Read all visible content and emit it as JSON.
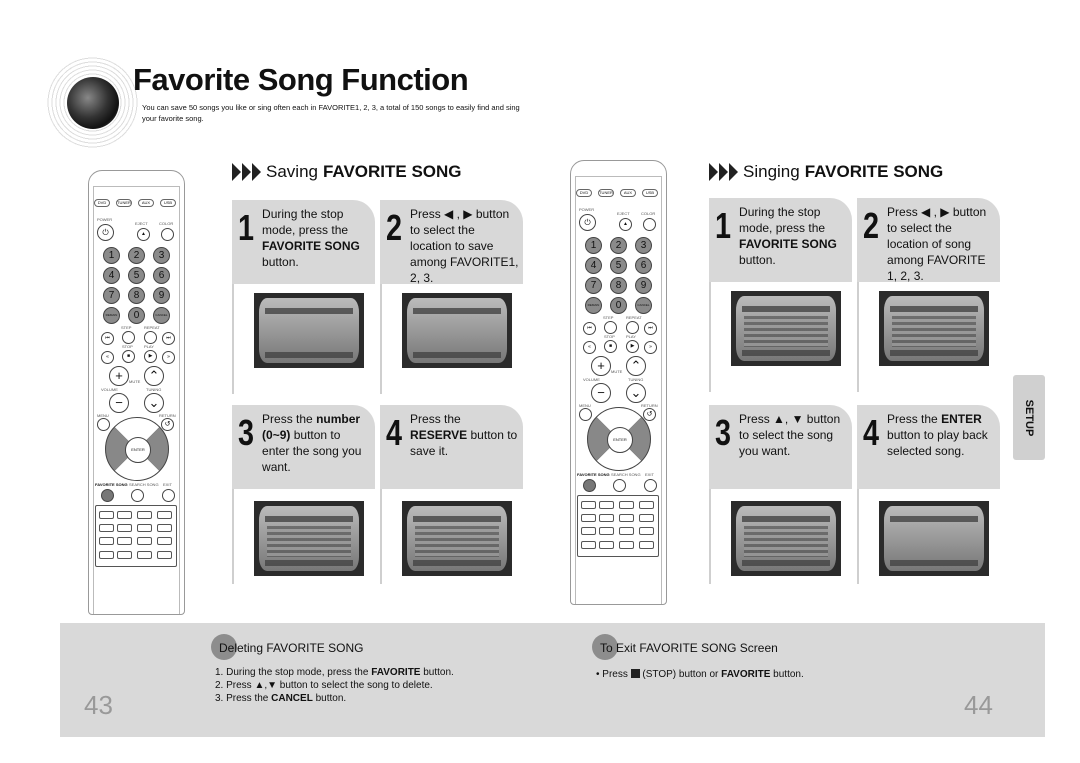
{
  "header": {
    "title": "Favorite Song Function",
    "intro": "You can save 50 songs you like or sing often each in FAVORITE1, 2, 3, a total of 150 songs to easily find and sing your favorite song."
  },
  "saving": {
    "heading_pre": "Saving ",
    "heading_bold": "FAVORITE SONG",
    "steps": [
      {
        "num": "1",
        "a": "During the stop mode, press the ",
        "b": "FAVORITE SONG",
        "c": " button."
      },
      {
        "num": "2",
        "a": "Press ◀ , ▶ button to select the location to save among FAVORITE1, 2, 3.",
        "b": "",
        "c": ""
      },
      {
        "num": "3",
        "a": "Press the ",
        "b": "number (0~9)",
        "c": " button to enter the song you want."
      },
      {
        "num": "4",
        "a": "Press the ",
        "b": "RESERVE",
        "c": " button to save it."
      }
    ]
  },
  "singing": {
    "heading_pre": "Singing ",
    "heading_bold": "FAVORITE SONG",
    "steps": [
      {
        "num": "1",
        "a": "During the stop mode, press the ",
        "b": "FAVORITE SONG",
        "c": " button."
      },
      {
        "num": "2",
        "a": "Press ◀ , ▶ button to select the location of song among FAVORITE 1, 2, 3.",
        "b": "",
        "c": ""
      },
      {
        "num": "3",
        "a": "Press ▲, ▼  button to select the song you want.",
        "b": "",
        "c": ""
      },
      {
        "num": "4",
        "a": "Press the ",
        "b": "ENTER",
        "c": " button to play back selected song."
      }
    ]
  },
  "side_tab": "SETUP",
  "remote": {
    "sources": [
      "DVD",
      "TUNER",
      "AUX",
      "USB"
    ],
    "power": "POWER",
    "eject": "EJECT",
    "color": "COLOR",
    "numbers": [
      "1",
      "2",
      "3",
      "4",
      "5",
      "6",
      "7",
      "8",
      "9",
      "REMAIN",
      "0",
      "CANCEL"
    ],
    "step": "STEP",
    "repeat": "REPEAT",
    "stop": "STOP",
    "play": "PLAY",
    "mute": "MUTE",
    "volume": "VOLUME",
    "tuning": "TUNING",
    "menu": "MENU",
    "return": "RETURN",
    "enter": "ENTER",
    "favorite_song": "FAVORITE SONG",
    "search_song": "SEARCH SONG",
    "exit": "EXIT"
  },
  "bottom": {
    "delete": {
      "heading": "Deleting FAVORITE SONG",
      "items": [
        {
          "a": "1. During the stop mode, press the ",
          "b": "FAVORITE",
          "c": " button."
        },
        {
          "a": "2. Press ▲,▼ button to select the song to delete.",
          "b": "",
          "c": ""
        },
        {
          "a": "3. Press the ",
          "b": "CANCEL",
          "c": " button."
        }
      ]
    },
    "exit": {
      "heading": "To Exit FAVORITE SONG Screen",
      "a": "• Press ",
      "b": " (STOP) button or ",
      "bold": "FAVORITE",
      "c": " button."
    },
    "page_left": "43",
    "page_right": "44"
  }
}
